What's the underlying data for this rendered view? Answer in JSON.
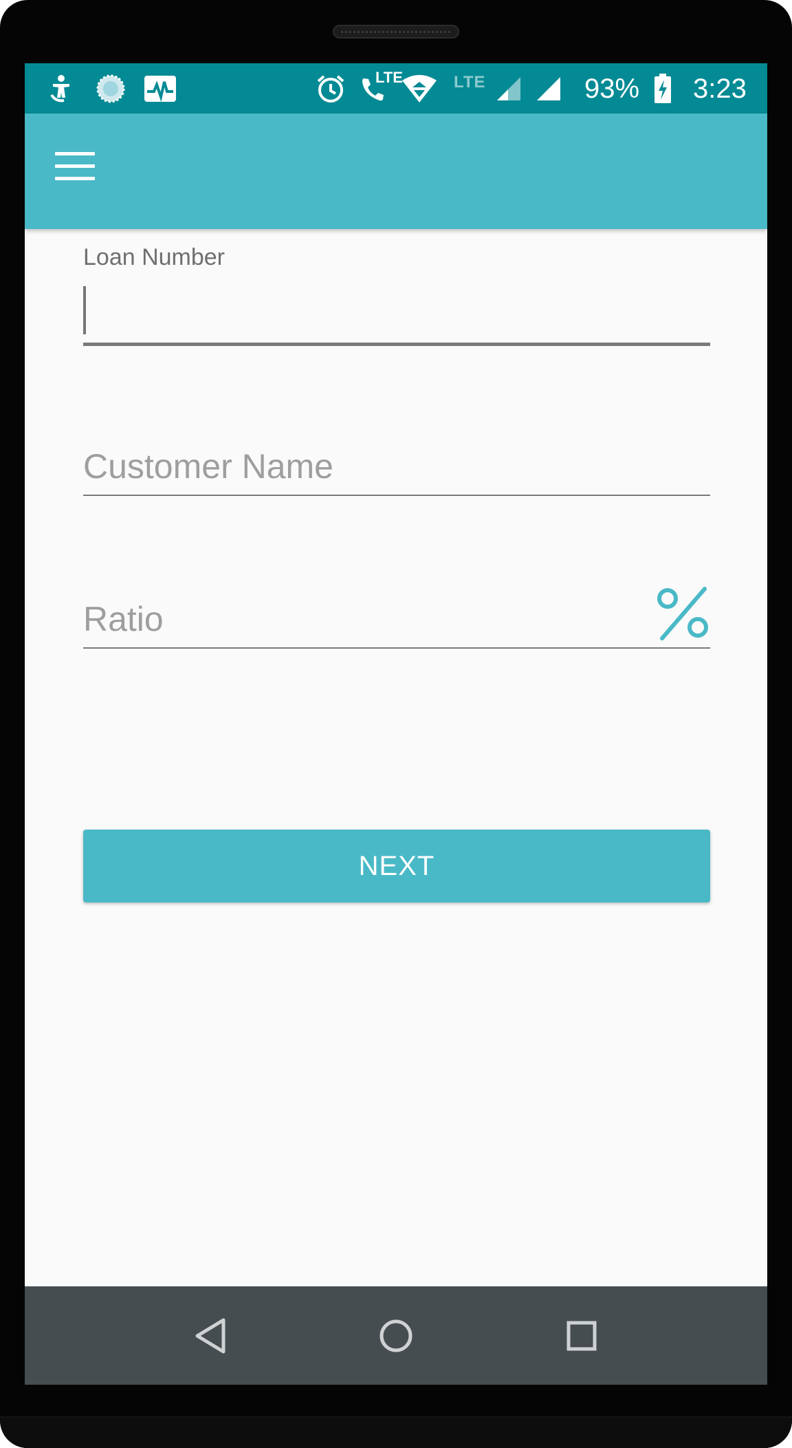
{
  "status_bar": {
    "lte_badge": "LTE",
    "lte_secondary": "LTE",
    "battery_percent": "93%",
    "time": "3:23",
    "icons": [
      "accessibility-icon",
      "sync-circle-icon",
      "activity-monitor-icon",
      "alarm-icon",
      "volte-call-icon",
      "wifi-icon",
      "signal-icon",
      "signal-icon",
      "battery-charging-icon"
    ]
  },
  "toolbar": {
    "menu_icon": "hamburger-menu-icon"
  },
  "form": {
    "loan_number": {
      "label": "Loan Number",
      "value": ""
    },
    "customer_name": {
      "placeholder": "Customer Name",
      "value": ""
    },
    "ratio": {
      "placeholder": "Ratio",
      "value": "",
      "icon": "percent-icon"
    },
    "next_label": "NEXT"
  },
  "nav_bar": {
    "icons": [
      "back-icon",
      "home-icon",
      "recents-icon"
    ]
  },
  "colors": {
    "status_bar": "#048a94",
    "primary": "#4ab9c7",
    "nav_bar": "#464d50",
    "background": "#fafafa"
  }
}
